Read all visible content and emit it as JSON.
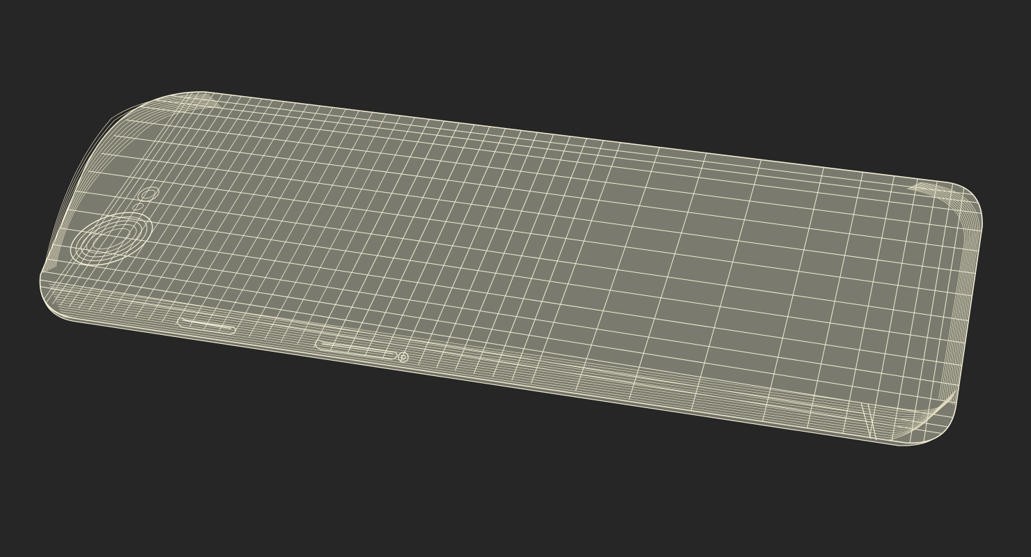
{
  "scene": {
    "subject": "smartphone-wireframe-render",
    "colors": {
      "background": "#262626",
      "surface": "#7a7a6e",
      "wire": "#f3eed6",
      "wire_dense": "#e8e2c4"
    }
  }
}
